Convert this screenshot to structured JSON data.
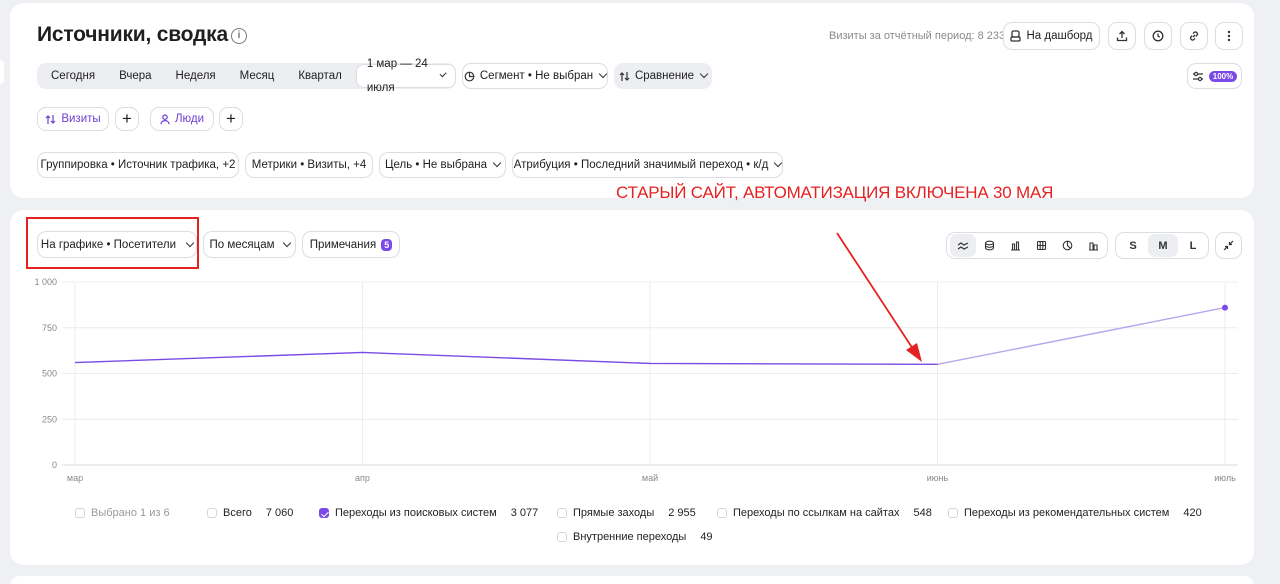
{
  "header": {
    "title": "Источники, сводка",
    "visits_period": "Визиты за отчётный период: 8 233",
    "dashboard_button": "На дашборд"
  },
  "period": {
    "options": [
      "Сегодня",
      "Вчера",
      "Неделя",
      "Месяц",
      "Квартал"
    ],
    "date_range": "1 мар — 24 июля"
  },
  "filters": {
    "segment": "Сегмент • Не выбран",
    "comparison": "Сравнение",
    "sampling_badge": "100%",
    "visits_tab": "Визиты",
    "people_tab": "Люди",
    "grouping": "Группировка • Источник трафика, +2",
    "metrics": "Метрики • Визиты, +4",
    "goal": "Цель • Не выбрана",
    "attribution": "Атрибуция • Последний значимый переход • к/д"
  },
  "annotation": {
    "text": "СТАРЫЙ САЙТ, АВТОМАТИЗАЦИЯ ВКЛЮЧЕНА 30 МАЯ",
    "color": "#e52222"
  },
  "chart_controls": {
    "on_chart": "На графике • Посетители",
    "period_grouping": "По месяцам",
    "notes": "Примечания",
    "notes_count": "5",
    "sizes": [
      "S",
      "M",
      "L"
    ],
    "active_size": "M"
  },
  "chart_data": {
    "type": "line",
    "x": [
      "мар",
      "апр",
      "май",
      "июнь",
      "июль"
    ],
    "yticks": [
      "1 000",
      "750",
      "500",
      "250",
      "0"
    ],
    "ylim": [
      0,
      1000
    ],
    "series": [
      {
        "name": "Переходы из поисковых систем",
        "values": [
          560,
          615,
          555,
          550,
          860
        ],
        "color": "#7b4ae6",
        "last_segment_partial": true
      }
    ],
    "grid": true
  },
  "legend": {
    "selected": "Выбрано 1 из 6",
    "items": [
      {
        "label": "Всего",
        "value": "7 060",
        "checked": false
      },
      {
        "label": "Переходы из поисковых систем",
        "value": "3 077",
        "checked": true
      },
      {
        "label": "Прямые заходы",
        "value": "2 955",
        "checked": false
      },
      {
        "label": "Переходы по ссылкам на сайтах",
        "value": "548",
        "checked": false
      },
      {
        "label": "Переходы из рекомендательных систем",
        "value": "420",
        "checked": false
      },
      {
        "label": "Внутренние переходы",
        "value": "49",
        "checked": false
      }
    ]
  }
}
